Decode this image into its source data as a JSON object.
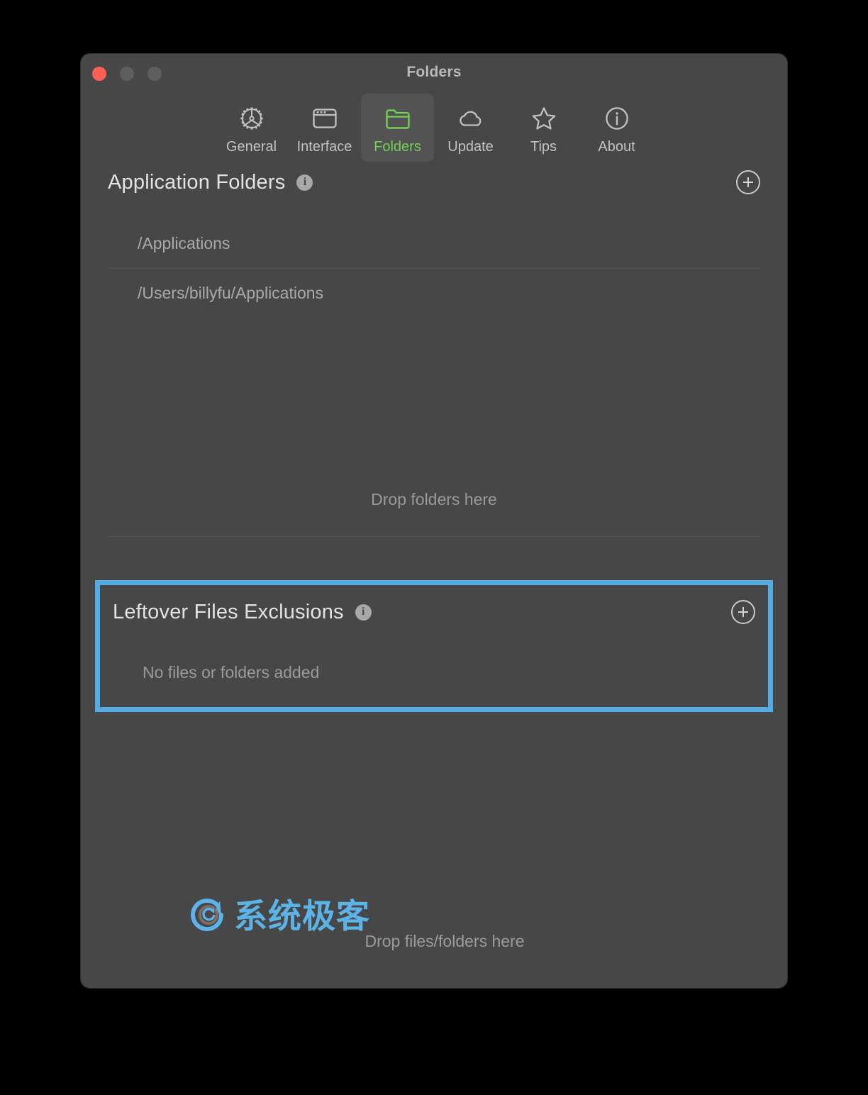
{
  "window": {
    "title": "Folders",
    "traffic_lights": [
      {
        "name": "close",
        "color": "#FF5F52"
      },
      {
        "name": "minimize",
        "color": "#5E5E5E"
      },
      {
        "name": "zoom",
        "color": "#5E5E5E"
      }
    ]
  },
  "toolbar": {
    "tabs": [
      {
        "label": "General",
        "icon": "gear-icon",
        "selected": false
      },
      {
        "label": "Interface",
        "icon": "window-icon",
        "selected": false
      },
      {
        "label": "Folders",
        "icon": "folder-icon",
        "selected": true
      },
      {
        "label": "Update",
        "icon": "cloud-icon",
        "selected": false
      },
      {
        "label": "Tips",
        "icon": "star-icon",
        "selected": false
      },
      {
        "label": "About",
        "icon": "info-circle-icon",
        "selected": false
      }
    ],
    "selected_color": "#74D055"
  },
  "application_folders": {
    "title": "Application Folders",
    "info_icon": "info-icon",
    "add_button": "plus-circle-icon",
    "items": [
      "/Applications",
      "/Users/billyfu/Applications"
    ],
    "drop_hint": "Drop folders here"
  },
  "leftover_exclusions": {
    "title": "Leftover Files Exclusions",
    "info_icon": "info-icon",
    "add_button": "plus-circle-icon",
    "empty_message": "No files or folders added",
    "highlight_color": "#55ACE3",
    "highlighted": true
  },
  "footer": {
    "watermark_text": "系统极客",
    "watermark_color": "#5BB3E8",
    "drop_hint": "Drop files/folders here"
  }
}
